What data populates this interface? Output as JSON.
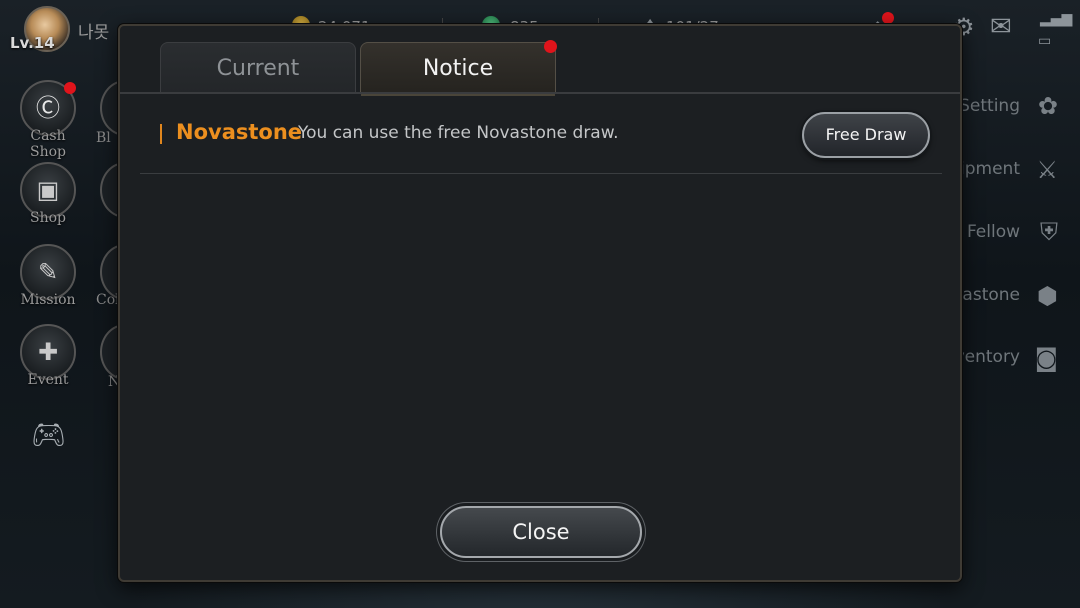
{
  "hud": {
    "level": "Lv.14",
    "player_name": "나못",
    "resource_1": "24,071",
    "resource_2": "835",
    "resource_3": "101/27"
  },
  "left_menu": [
    {
      "label": "Cash Shop",
      "icon": "cash-shop-icon",
      "badge": "NEW"
    },
    {
      "label": "Shop",
      "icon": "chest-icon"
    },
    {
      "label": "Mission",
      "icon": "scroll-icon"
    },
    {
      "label": "Event",
      "icon": "gift-icon"
    }
  ],
  "left_menu_2": [
    "Bl",
    "Col",
    "N"
  ],
  "right_menu": [
    {
      "label": "Setting",
      "icon": "gear-icon"
    },
    {
      "label": "ipment",
      "icon": "crossed-swords-icon"
    },
    {
      "label": "Fellow",
      "icon": "helmet-icon"
    },
    {
      "label": "vastone",
      "icon": "hexagon-icon"
    },
    {
      "label": "ventory",
      "icon": "bag-icon"
    }
  ],
  "dialog": {
    "tabs": [
      {
        "label": "Current",
        "active": false
      },
      {
        "label": "Notice",
        "active": true,
        "has_alert": true
      }
    ],
    "notices": [
      {
        "title": "Novastone",
        "text": "You can use the free Novastone draw.",
        "button": "Free Draw"
      }
    ],
    "close_label": "Close"
  },
  "colors": {
    "accent_orange": "#ec8f1f",
    "alert_red": "#e0141b",
    "dialog_bg": "#1c1f22"
  }
}
